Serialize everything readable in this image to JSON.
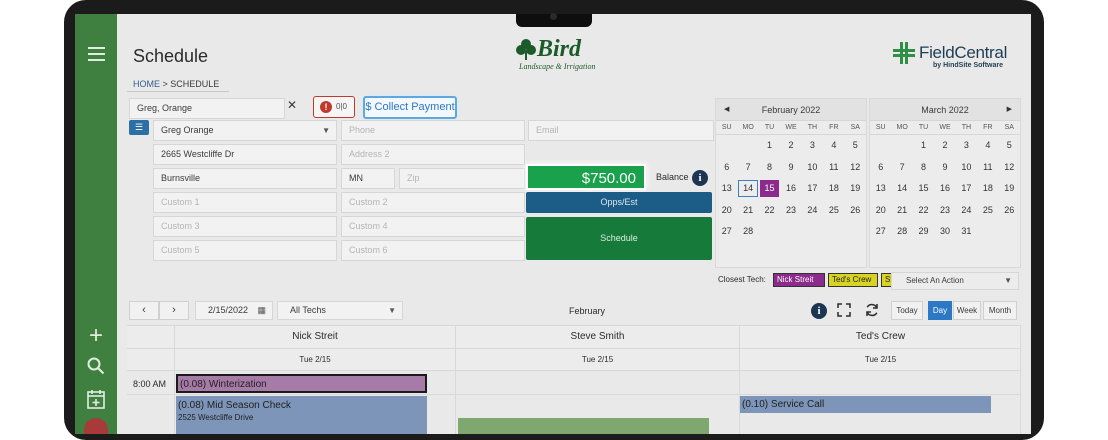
{
  "header": {
    "title": "Schedule",
    "brand": {
      "name": "Bird",
      "tagline": "Landscape & Irrigation"
    },
    "vendor": {
      "name": "FieldCentral",
      "byline": "by HindSite Software"
    }
  },
  "breadcrumb": {
    "home": "HOME",
    "separator": " > ",
    "current": "SCHEDULE"
  },
  "customer_form": {
    "search_value": "Greg, Orange",
    "alert_count": "0|0",
    "collect_payment_label": "$ Collect Payment",
    "contact_name": "Greg Orange",
    "phone_placeholder": "Phone",
    "email_placeholder": "Email",
    "address1": "2665 Westcliffe Dr",
    "address2_placeholder": "Address 2",
    "city": "Burnsville",
    "state": "MN",
    "zip_placeholder": "Zip",
    "custom_placeholders": [
      "Custom 1",
      "Custom 2",
      "Custom 3",
      "Custom 4",
      "Custom 5",
      "Custom 6"
    ]
  },
  "balance": {
    "amount": "$750.00",
    "label": "Balance"
  },
  "actions": {
    "opps_label": "Opps/Est",
    "schedule_label": "Schedule"
  },
  "calendars": [
    {
      "month": "February 2022",
      "days_of_week": [
        "SU",
        "MO",
        "TU",
        "WE",
        "TH",
        "FR",
        "SA"
      ],
      "days": [
        "",
        "",
        "1",
        "2",
        "3",
        "4",
        "5",
        "6",
        "7",
        "8",
        "9",
        "10",
        "11",
        "12",
        "13",
        "14",
        "15",
        "16",
        "17",
        "18",
        "19",
        "20",
        "21",
        "22",
        "23",
        "24",
        "25",
        "26",
        "27",
        "28"
      ],
      "today": "14",
      "selected": "15"
    },
    {
      "month": "March 2022",
      "days_of_week": [
        "SU",
        "MO",
        "TU",
        "WE",
        "TH",
        "FR",
        "SA"
      ],
      "days": [
        "",
        "",
        "1",
        "2",
        "3",
        "4",
        "5",
        "6",
        "7",
        "8",
        "9",
        "10",
        "11",
        "12",
        "13",
        "14",
        "15",
        "16",
        "17",
        "18",
        "19",
        "20",
        "21",
        "22",
        "23",
        "24",
        "25",
        "26",
        "27",
        "28",
        "29",
        "30",
        "31"
      ]
    }
  ],
  "closest_tech": {
    "label": "Closest Tech:",
    "techs": [
      {
        "name": "Nick Streit",
        "color": "#8c2b8c"
      },
      {
        "name": "Ted's Crew",
        "color": "#d8d420"
      },
      {
        "name": "St",
        "color": "#d8d420"
      }
    ],
    "action_placeholder": "Select An Action"
  },
  "scheduler_toolbar": {
    "date": "2/15/2022",
    "tech_filter": "All Techs",
    "month_label": "February",
    "today_label": "Today",
    "views": [
      "Day",
      "Week",
      "Month"
    ],
    "active_view": "Day"
  },
  "columns": [
    {
      "name": "Nick Streit",
      "date": "Tue 2/15"
    },
    {
      "name": "Steve Smith",
      "date": "Tue 2/15"
    },
    {
      "name": "Ted's Crew",
      "date": "Tue 2/15"
    }
  ],
  "time_slots": [
    "8:00 AM"
  ],
  "events": [
    {
      "title": "(0.08) Winterization",
      "color": "#a77ba7"
    },
    {
      "title": "(0.08) Mid Season Check",
      "address": "2525 Westcliffe Drive",
      "color": "#7d95b8"
    },
    {
      "title": "(0.10) Service Call",
      "color": "#7d95b8"
    },
    {
      "title": "",
      "color": "#7fa870"
    }
  ],
  "colors": {
    "sidebar": "#3f7f3f",
    "accent_green": "#19a14b",
    "accent_blue": "#1c5d87",
    "selected_day": "#8c2b8c"
  }
}
